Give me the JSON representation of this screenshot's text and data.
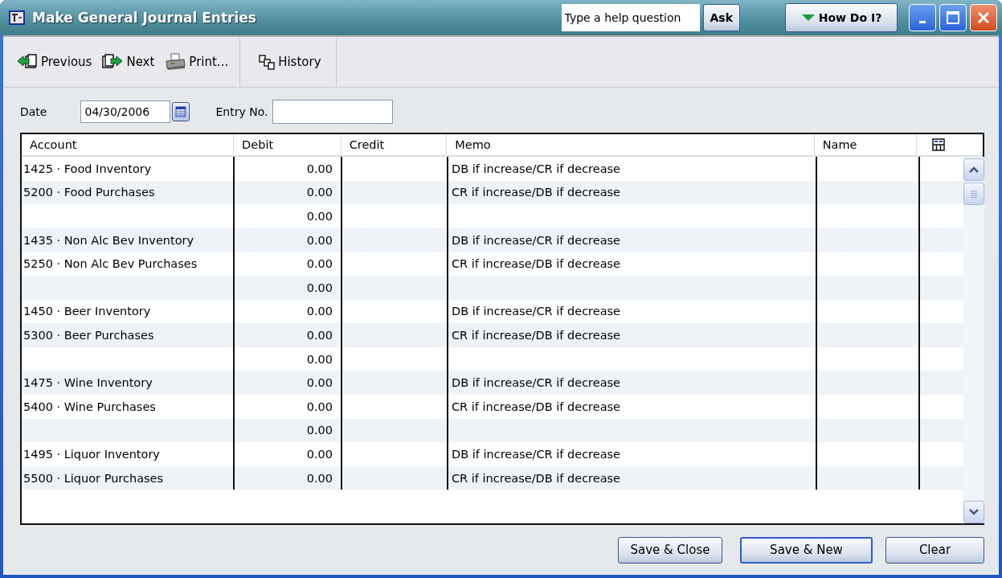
{
  "window": {
    "title": "Make General Journal Entries"
  },
  "help": {
    "placeholder": "Type a help question",
    "ask": "Ask",
    "how_do_i": "How Do I?"
  },
  "toolbar": [
    {
      "kind": "previous",
      "label": "Previous"
    },
    {
      "kind": "next",
      "label": "Next"
    },
    {
      "kind": "print",
      "label": "Print..."
    },
    {
      "kind": "history",
      "label": "History"
    }
  ],
  "form": {
    "date_label": "Date",
    "date": "04/30/2006",
    "entry_label": "Entry No."
  },
  "table": {
    "columns": [
      "Account",
      "Debit",
      "Credit",
      "Memo",
      "Name"
    ],
    "rows": [
      {
        "account": "1425 · Food Inventory",
        "debit": "0.00",
        "memo": "DB if increase/CR if decrease"
      },
      {
        "account": "5200 · Food Purchases",
        "debit": "0.00",
        "memo": "CR if increase/DB if decrease"
      },
      {
        "debit": "0.00"
      },
      {
        "account": "1435 · Non Alc Bev Inventory",
        "debit": "0.00",
        "memo": "DB if increase/CR if decrease"
      },
      {
        "account": "5250 · Non Alc Bev Purchases",
        "debit": "0.00",
        "memo": "CR if increase/DB if decrease"
      },
      {
        "debit": "0.00"
      },
      {
        "account": "1450 · Beer Inventory",
        "debit": "0.00",
        "memo": "DB if increase/CR if decrease"
      },
      {
        "account": "5300 · Beer Purchases",
        "debit": "0.00",
        "memo": "CR if increase/DB if decrease"
      },
      {
        "debit": "0.00"
      },
      {
        "account": "1475 · Wine Inventory",
        "debit": "0.00",
        "memo": "DB if increase/CR if decrease"
      },
      {
        "account": "5400 · Wine Purchases",
        "debit": "0.00",
        "memo": "CR if increase/DB if decrease"
      },
      {
        "debit": "0.00"
      },
      {
        "account": "1495 · Liquor Inventory",
        "debit": "0.00",
        "memo": "DB if increase/CR if decrease"
      },
      {
        "account": "5500 · Liquor Purchases",
        "debit": "0.00",
        "memo": "CR if increase/DB if decrease"
      }
    ]
  },
  "buttons": [
    {
      "label": "Save & Close",
      "selected": false
    },
    {
      "label": "Save & New",
      "selected": true
    },
    {
      "label": "Clear",
      "selected": false
    }
  ]
}
